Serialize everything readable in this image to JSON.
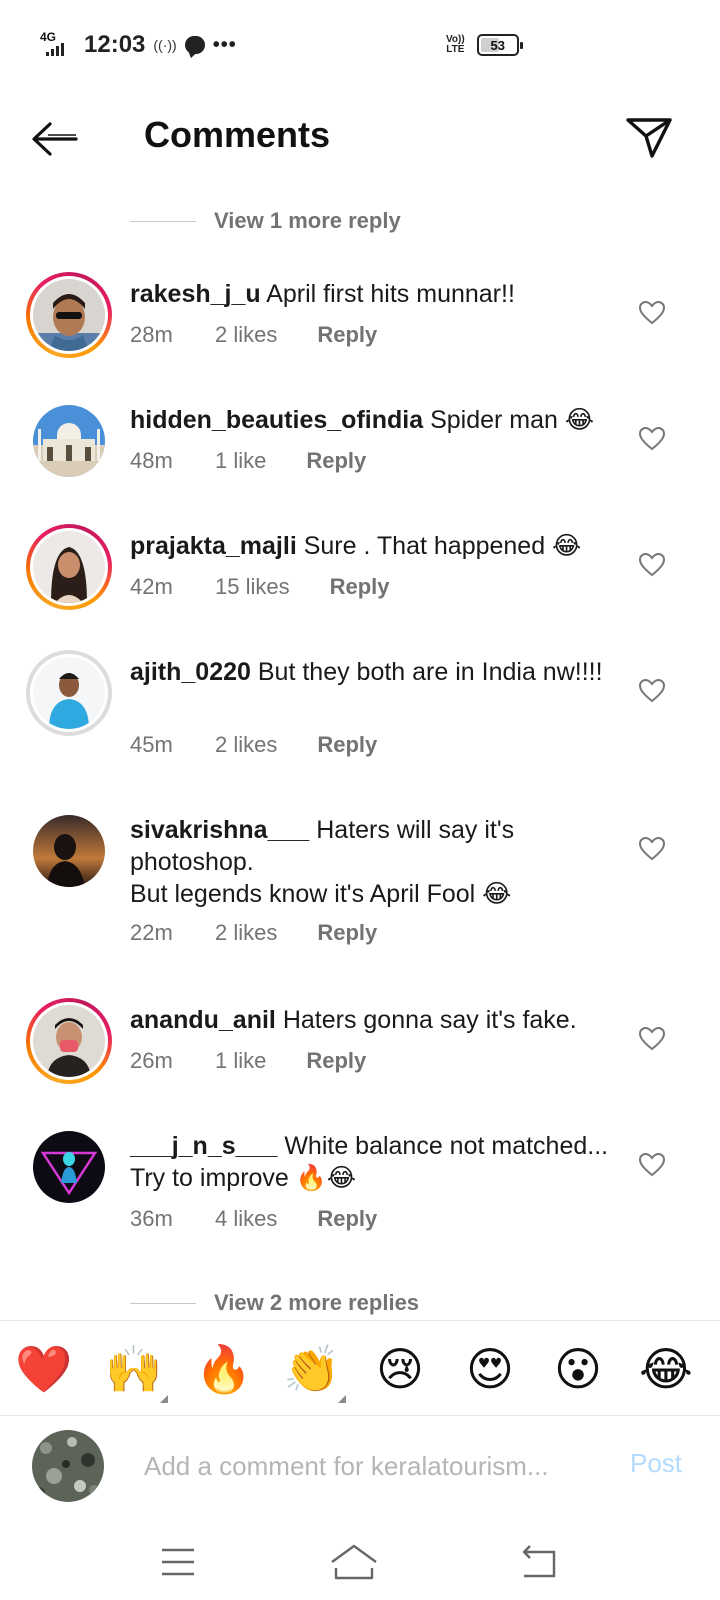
{
  "status_bar": {
    "network": "4G",
    "time": "12:03",
    "hotspot_glyph": "((·))",
    "more_glyph": "•••",
    "volte_top": "Vo))",
    "volte_bottom": "LTE",
    "battery": "53",
    "battery_level_percent": 53
  },
  "header": {
    "title": "Comments",
    "back_icon": "arrow-left-icon",
    "send_icon": "paper-plane-icon"
  },
  "view_more_top": "View 1 more reply",
  "comments": [
    {
      "username": "rakesh_j_u",
      "text": "April first hits munnar!!",
      "age": "28m",
      "likes": "2 likes",
      "reply": "Reply",
      "story_ring": true
    },
    {
      "username": "hidden_beauties_ofindia",
      "text": "Spider man 😂",
      "age": "48m",
      "likes": "1 like",
      "reply": "Reply",
      "story_ring": false
    },
    {
      "username": "prajakta_majli",
      "text": "Sure . That happened 😂",
      "age": "42m",
      "likes": "15 likes",
      "reply": "Reply",
      "story_ring": true
    },
    {
      "username": "ajith_0220",
      "text": "But they both are in India nw!!!!",
      "age": "45m",
      "likes": "2 likes",
      "reply": "Reply",
      "story_ring": false
    },
    {
      "username": "sivakrishna___",
      "text": "Haters will say it's photoshop.\nBut legends know it's April Fool 😂",
      "age": "22m",
      "likes": "2 likes",
      "reply": "Reply",
      "story_ring": false
    },
    {
      "username": "anandu_anil",
      "text": "Haters gonna say it's fake.",
      "age": "26m",
      "likes": "1 like",
      "reply": "Reply",
      "story_ring": true
    },
    {
      "username": "___j_n_s___",
      "text": "White balance not matched... Try to improve 🔥😂",
      "age": "36m",
      "likes": "4 likes",
      "reply": "Reply",
      "story_ring": false
    }
  ],
  "view_more_bottom": "View 2 more replies",
  "emoji_bar": [
    "❤️",
    "🙌",
    "🔥",
    "👏",
    "😢",
    "😍",
    "😮",
    "😂"
  ],
  "comment_box": {
    "placeholder": "Add a comment for keralatourism...",
    "post_label": "Post"
  },
  "colors": {
    "meta_grey": "#737373",
    "post_disabled": "#b3dbff",
    "story_ring_start": "#f9a825",
    "story_ring_end": "#e91e63"
  }
}
